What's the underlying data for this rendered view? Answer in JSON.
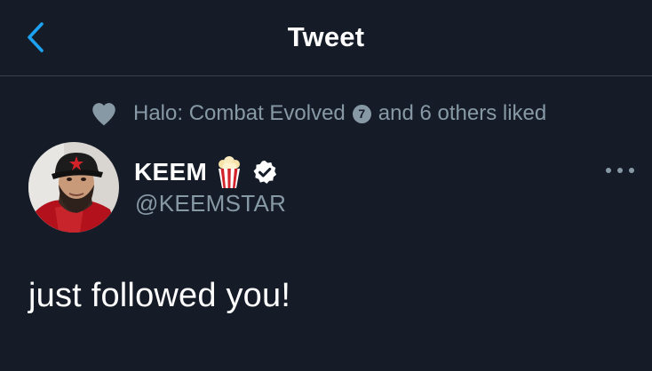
{
  "header": {
    "title": "Tweet",
    "back_icon": "chevron-left-icon"
  },
  "social_context": {
    "icon": "heart-icon",
    "liker_name": "Halo: Combat Evolved",
    "badge": "7",
    "suffix": "and 6 others liked"
  },
  "tweet": {
    "author_name": "KEEM",
    "emoji": "popcorn",
    "verified_icon": "verified-badge-icon",
    "handle": "@KEEMSTAR",
    "text": "just followed you!",
    "more_icon": "more-options-icon"
  },
  "colors": {
    "background": "#151c28",
    "accent": "#1da1f2",
    "secondary_text": "#8899a6",
    "divider": "#38444d"
  }
}
